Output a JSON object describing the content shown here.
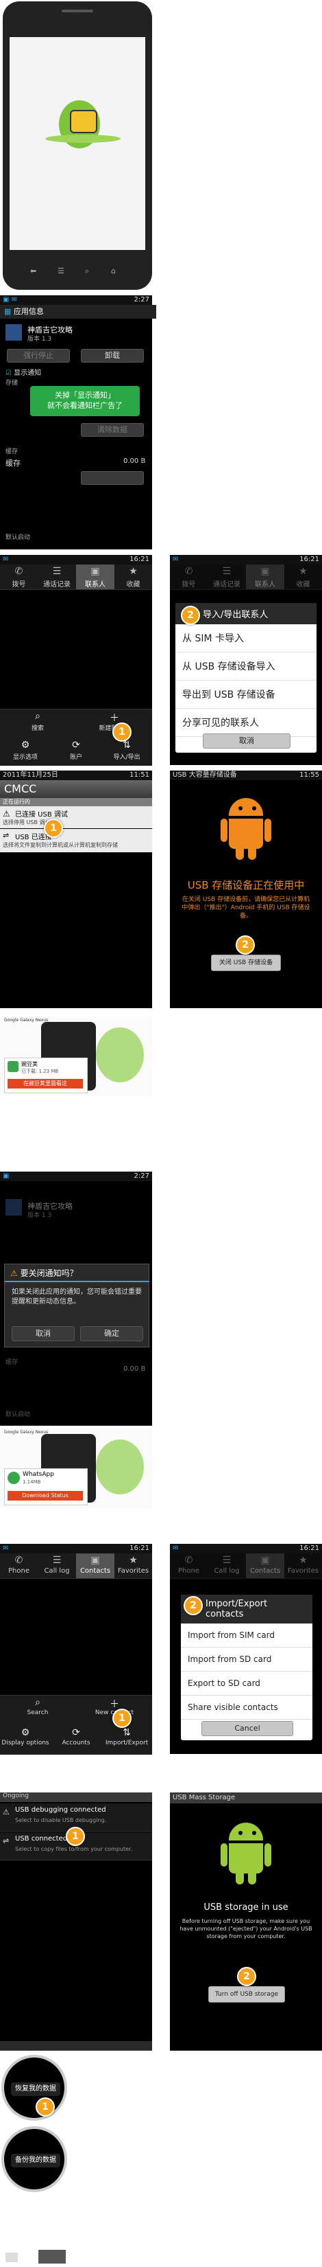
{
  "colors": {
    "accent_orange": "#f6a11a",
    "android_orange": "#f08a1d",
    "android_green": "#9ccb3b",
    "tooltip_green": "#2aa845",
    "blue": "#2ea3e6"
  },
  "phone_mock": {
    "icon": "peas-mascot-icon"
  },
  "s1": {
    "status_time": "2:27",
    "title": "应用信息",
    "app_name": "神盾吉它攻略",
    "version": "版本 1.3",
    "force_stop": "强行停止",
    "uninstall": "卸载",
    "show_notice": "显示通知",
    "storage_label": "存储",
    "tooltip_line1": "关掉「显示通知」",
    "tooltip_line2": "就不会看通知栏广告了",
    "clear_data": "清除数据",
    "cache_label": "缓存",
    "cache_label2": "缓存",
    "cache_value": "0.00 B",
    "default_launch": "默认启动"
  },
  "s2": {
    "status_time": "16:21",
    "tabs": [
      "拨号",
      "通话记录",
      "联系人",
      "收藏"
    ],
    "search": "搜索",
    "new_contact": "新建联系人",
    "display_options": "显示选项",
    "accounts": "账户",
    "import_export": "导入/导出",
    "marker": "1"
  },
  "s3": {
    "status_time": "16:21",
    "tabs": [
      "拨号",
      "通话记录",
      "联系人",
      "收藏"
    ],
    "dialog_title": "导入/导出联系人",
    "options": [
      "从 SIM 卡导入",
      "从 USB 存储设备导入",
      "导出到 USB 存储设备",
      "分享可见的联系人"
    ],
    "cancel": "取消",
    "marker": "2"
  },
  "s4": {
    "status_time": "11:51",
    "date": "2011年11月25日",
    "carrier": "CMCC",
    "ongoing": "正在运行的",
    "usb_debug_title": "已连接 USB 调试",
    "usb_debug_sub": "选择停用 USB 调试。",
    "usb_conn_title": "USB 已连接",
    "usb_conn_sub": "选择将文件复制到计算机或从计算机复制到存储",
    "marker": "1"
  },
  "s5": {
    "status_time": "11:55",
    "header": "USB 大容量存储设备",
    "title": "USB 存储设备正在使用中",
    "desc": "在关闭 USB 存储设备前，请确保您已从计算机中弹出（\"推出\"）Android 手机的 USB 存储设备。",
    "button": "关闭 USB 存储设备",
    "marker": "2"
  },
  "s6": {
    "wandou": "豌豆荚",
    "wandou_sub": "已下载: 1.23 MB",
    "download_label": "在豌豆荚里面看这",
    "phone_caption": "Google Galaxy Nexus"
  },
  "s7": {
    "status_time": "2:27",
    "title": "应用信息",
    "app_name": "神盾吉它攻略",
    "version": "版本 1.3",
    "dialog_title": "要关闭通知吗？",
    "dialog_text": "如果关闭此应用的通知，您可能会错过重要提醒和更新动态信息。",
    "cancel": "取消",
    "ok": "确定",
    "cache_label": "缓存",
    "cache_value": "0.00 B",
    "default_launch": "默认启动"
  },
  "s8": {
    "app": "WhatsApp",
    "app_sub": "1.14MB",
    "download": "Download Status",
    "phone_caption": "Google Galaxy Nexus"
  },
  "s9": {
    "status_time": "16:21",
    "tabs": [
      "Phone",
      "Call log",
      "Contacts",
      "Favorites"
    ],
    "search": "Search",
    "new_contact": "New contact",
    "display_options": "Display options",
    "accounts": "Accounts",
    "import_export": "Import/Export",
    "marker": "1"
  },
  "s10": {
    "status_time": "16:21",
    "tabs": [
      "Phone",
      "Call log",
      "Contacts",
      "Favorites"
    ],
    "dialog_title": "Import/Export contacts",
    "options": [
      "Import from SIM card",
      "Import from SD card",
      "Export to SD card",
      "Share visible contacts"
    ],
    "cancel": "Cancel",
    "marker": "2"
  },
  "s11": {
    "ongoing": "Ongoing",
    "usb_debug_title": "USB debugging connected",
    "usb_debug_sub": "Select to disable USB debugging.",
    "usb_conn_title": "USB connected",
    "usb_conn_sub": "Select to copy files to/from your computer.",
    "marker": "1"
  },
  "s12": {
    "header": "USB Mass Storage",
    "title": "USB storage in use",
    "desc": "Before turning off USB storage, make sure you have unmounted (\"ejected\") your Android's USB storage from your computer.",
    "button": "Turn off USB storage",
    "marker": "2"
  },
  "s13": {
    "restore_label": "恢复我的数据",
    "backup_label": "备份我的数据",
    "marker": "1"
  }
}
